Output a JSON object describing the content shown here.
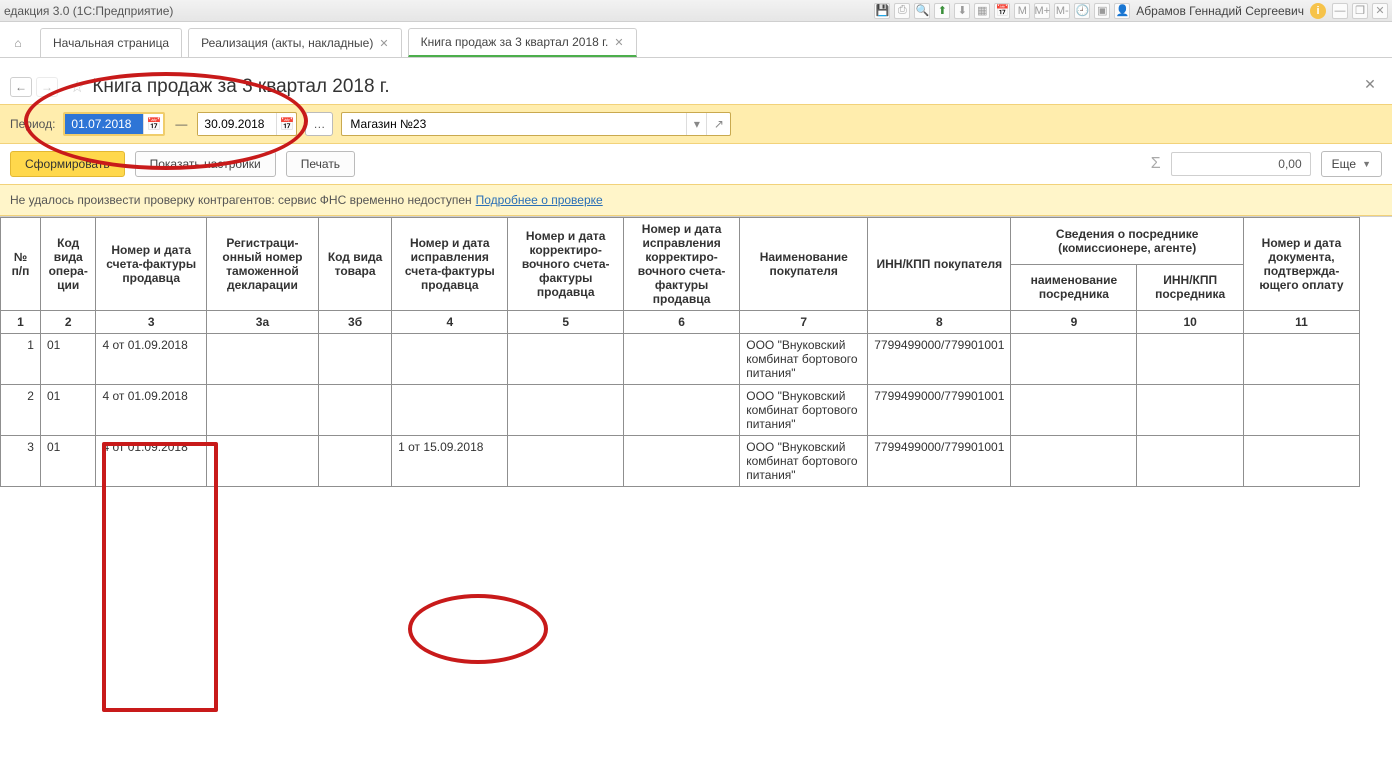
{
  "titlebar": {
    "app_title": "едакция 3.0  (1С:Предприятие)",
    "user": "Абрамов Геннадий Сергеевич"
  },
  "tabs": {
    "home": "Начальная страница",
    "t1": "Реализация (акты, накладные)",
    "t2": "Книга продаж за 3 квартал 2018 г."
  },
  "page_title": "Книга продаж за 3 квартал 2018 г.",
  "period": {
    "label": "Период:",
    "from": "01.07.2018",
    "to": "30.09.2018",
    "org": "Магазин №23"
  },
  "actions": {
    "form": "Сформировать",
    "settings": "Показать настройки",
    "print": "Печать",
    "sum": "0,00",
    "more": "Еще"
  },
  "warning": {
    "text": "Не удалось произвести проверку контрагентов: сервис ФНС временно недоступен",
    "link": "Подробнее о проверке"
  },
  "headers": {
    "c1": "№\nп/п",
    "c2": "Код вида опера-ции",
    "c3": "Номер и дата счета-фактуры продавца",
    "c3a": "Регистраци-онный номер таможенной декларации",
    "c3b": "Код вида товара",
    "c4": "Номер и дата исправления счета-фактуры продавца",
    "c5": "Номер и дата корректиро-вочного счета-фактуры продавца",
    "c6": "Номер и дата исправления корректиро-вочного счета-фактуры продавца",
    "c7": "Наименование покупателя",
    "c8": "ИНН/КПП покупателя",
    "c_agent": "Сведения о посреднике (комиссионере, агенте)",
    "c9": "наименование посредника",
    "c10": "ИНН/КПП посредника",
    "c11": "Номер и дата документа, подтвержда-ющего оплату"
  },
  "colnums": {
    "n1": "1",
    "n2": "2",
    "n3": "3",
    "n3a": "3а",
    "n3b": "3б",
    "n4": "4",
    "n5": "5",
    "n6": "6",
    "n7": "7",
    "n8": "8",
    "n9": "9",
    "n10": "10",
    "n11": "11"
  },
  "rows": [
    {
      "n": "1",
      "op": "01",
      "sf": "4 от 01.09.2018",
      "c3a": "",
      "c3b": "",
      "c4": "",
      "c5": "",
      "c6": "",
      "buyer": "ООО \"Внуковский комбинат бортового питания\"",
      "inn": "7799499000/779901001",
      "c9": "",
      "c10": "",
      "c11": ""
    },
    {
      "n": "2",
      "op": "01",
      "sf": "4 от 01.09.2018",
      "c3a": "",
      "c3b": "",
      "c4": "",
      "c5": "",
      "c6": "",
      "buyer": "ООО \"Внуковский комбинат бортового питания\"",
      "inn": "7799499000/779901001",
      "c9": "",
      "c10": "",
      "c11": ""
    },
    {
      "n": "3",
      "op": "01",
      "sf": "4 от 01.09.2018",
      "c3a": "",
      "c3b": "",
      "c4": "1 от 15.09.2018",
      "c5": "",
      "c6": "",
      "buyer": "ООО \"Внуковский комбинат бортового питания\"",
      "inn": "7799499000/779901001",
      "c9": "",
      "c10": "",
      "c11": ""
    }
  ]
}
